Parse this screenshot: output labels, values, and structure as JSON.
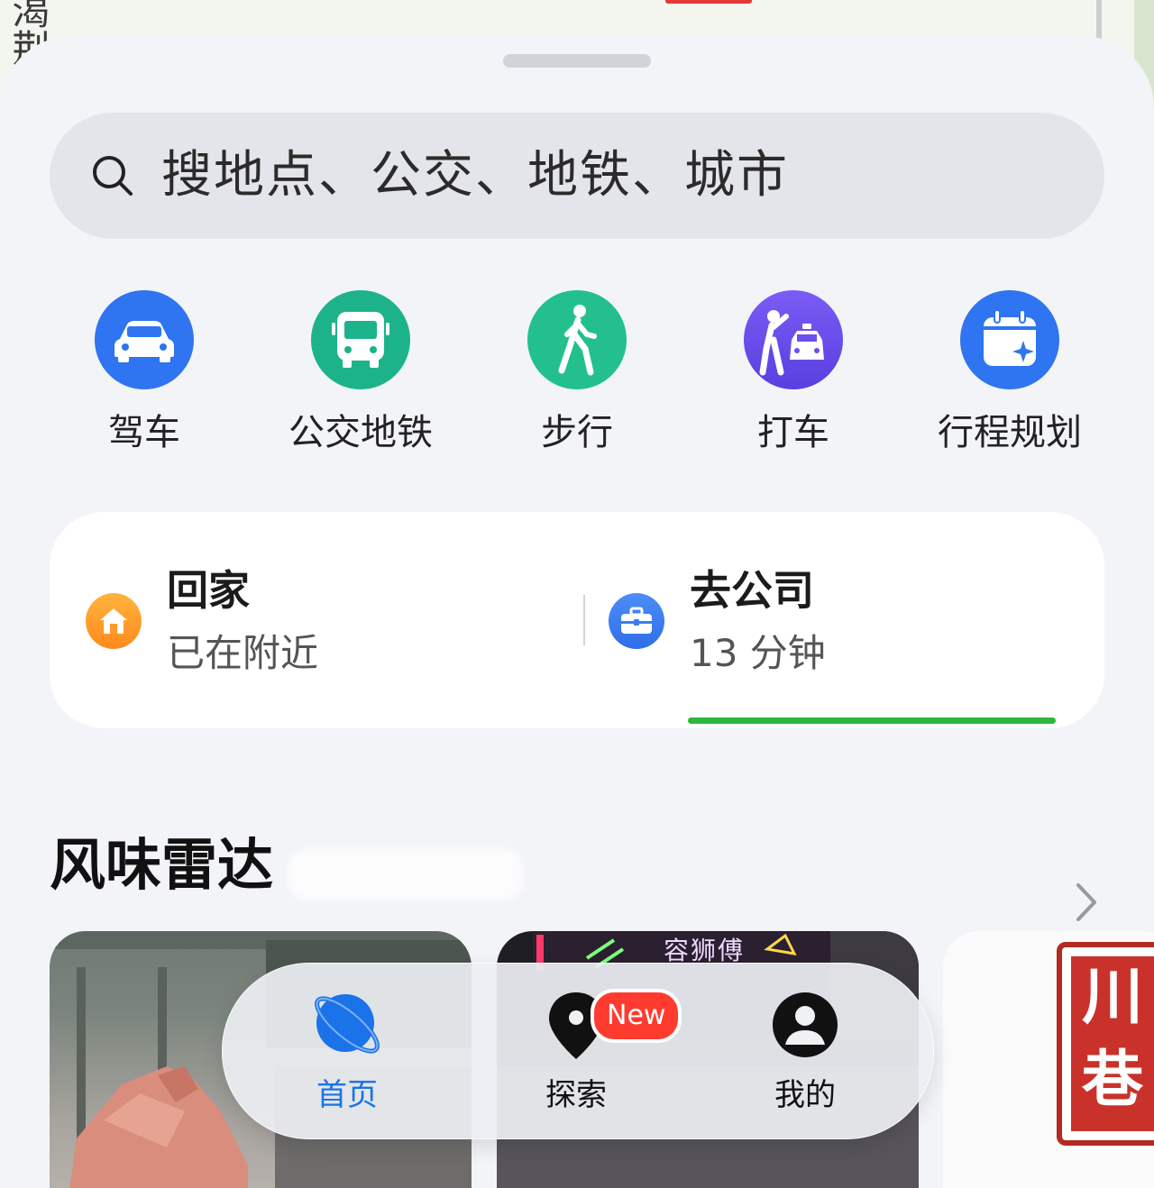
{
  "map": {
    "partial_label": "渴荆"
  },
  "search": {
    "placeholder": "搜地点、公交、地铁、城市",
    "icon": "search-icon"
  },
  "quick_actions": [
    {
      "label": "驾车",
      "icon": "car-icon",
      "color": "#2f74f0"
    },
    {
      "label": "公交地铁",
      "icon": "bus-icon",
      "color": "#1db38a"
    },
    {
      "label": "步行",
      "icon": "walk-icon",
      "color": "#23c08e"
    },
    {
      "label": "打车",
      "icon": "taxi-hail-icon",
      "color": "#6a4ff0"
    },
    {
      "label": "行程规划",
      "icon": "calendar-sparkle-icon",
      "color": "#2f74f0"
    }
  ],
  "commute": {
    "home": {
      "title": "回家",
      "subtitle": "已在附近",
      "icon": "home-icon"
    },
    "work": {
      "title": "去公司",
      "subtitle": "13 分钟",
      "icon": "briefcase-icon",
      "progress": 1.0,
      "progress_color": "#2db83d"
    }
  },
  "section": {
    "title": "风味雷达",
    "more_icon": "chevron-right-icon"
  },
  "cards": [
    {
      "name": "bear-sculpture-photo"
    },
    {
      "name": "neon-restaurant-photo",
      "sign_text": "容狮傅"
    },
    {
      "name": "chuanxiang-logo-photo",
      "logo_text": "川巷"
    }
  ],
  "tabbar": {
    "items": [
      {
        "label": "首页",
        "icon": "planet-icon",
        "active": true
      },
      {
        "label": "探索",
        "icon": "map-pin-icon",
        "active": false,
        "badge": "New"
      },
      {
        "label": "我的",
        "icon": "person-icon",
        "active": false
      }
    ],
    "active_color": "#1a73e8"
  }
}
